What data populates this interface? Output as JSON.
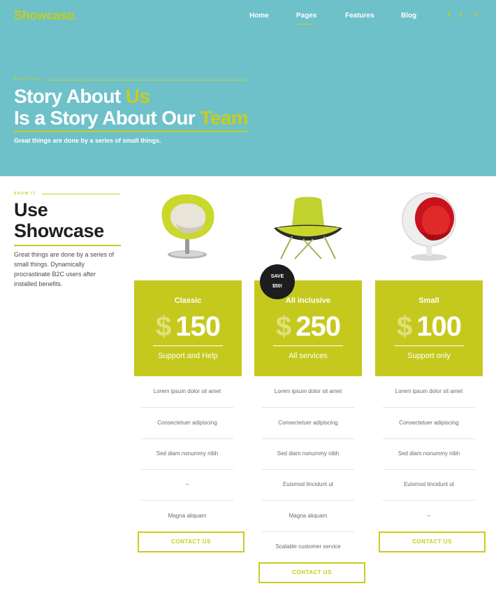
{
  "brand": {
    "logo": "Showcase.",
    "accent": "#c8cc1f",
    "hero_bg": "#6ec1c9"
  },
  "nav": {
    "items": [
      {
        "label": "Home"
      },
      {
        "label": "Pages",
        "active": true
      },
      {
        "label": "Features"
      },
      {
        "label": "Blog"
      }
    ],
    "social": [
      {
        "icon": "facebook-icon",
        "glyph": "f"
      },
      {
        "icon": "twitter-icon",
        "glyph": "t"
      },
      {
        "icon": "vimeo-icon",
        "glyph": "v"
      }
    ]
  },
  "hero": {
    "eyebrow": "ABOUT US",
    "title_line1_a": "Story About ",
    "title_line1_b": "Us",
    "title_line2_a": "Is a Story About Our ",
    "title_line2_b": "Team",
    "subtitle": "Great things are done by a series of small things."
  },
  "intro": {
    "eyebrow": "SHOW IT",
    "title_line1": "Use",
    "title_line2": "Showcase",
    "description": "Great things are done by a series of small things. Dynamically procrastinate B2C users after installed benefits."
  },
  "badge": {
    "line1": "SAVE",
    "line2": "$50!"
  },
  "plans": [
    {
      "name": "Classic",
      "currency": "$",
      "price": "150",
      "description": "Support and Help",
      "features": [
        "Lorem ipsum dolor sit amet",
        "Consectetuer adipiscing",
        "Sed diam nonummy nibh",
        "–",
        "Magna aliquam"
      ],
      "cta": "CONTACT US"
    },
    {
      "name": "All inclusive",
      "currency": "$",
      "price": "250",
      "description": "All services",
      "features": [
        "Lorem ipsum dolor sit amet",
        "Consectetuer adipiscing",
        "Sed diam nonummy nibh",
        "Euismod tincidunt ut",
        "Magna aliquam",
        "Scalable customer service"
      ],
      "cta": "CONTACT US"
    },
    {
      "name": "Small",
      "currency": "$",
      "price": "100",
      "description": "Support only",
      "features": [
        "Lorem ipsum dolor sit amet",
        "Consectetuer adipiscing",
        "Sed diam nonummy nibh",
        "Euismod tincidunt ut",
        "–"
      ],
      "cta": "CONTACT US"
    }
  ]
}
